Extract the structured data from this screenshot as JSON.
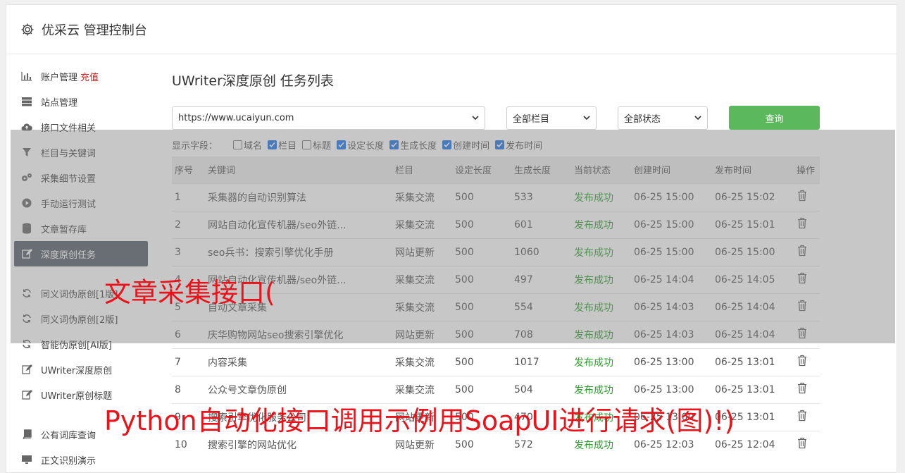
{
  "header": {
    "title": "优采云 管理控制台"
  },
  "sidebar": {
    "items": [
      {
        "label": "账户管理",
        "badge": "充值",
        "icon": "bar-chart-icon"
      },
      {
        "label": "站点管理",
        "icon": "server-icon"
      },
      {
        "label": "接口文件相关",
        "icon": "cloud-upload-icon"
      },
      {
        "label": "栏目与关键词",
        "icon": "filter-icon"
      },
      {
        "label": "采集细节设置",
        "icon": "gears-icon"
      },
      {
        "label": "手动运行测试",
        "icon": "play-icon"
      },
      {
        "label": "文章暂存库",
        "icon": "database-icon"
      },
      {
        "label": "深度原创任务",
        "icon": "edit-icon"
      },
      {
        "label": "同义词伪原创[1版]",
        "icon": "refresh-icon"
      },
      {
        "label": "同义词伪原创[2版]",
        "icon": "refresh-icon"
      },
      {
        "label": "智能伪原创[AI版]",
        "icon": "refresh-icon"
      },
      {
        "label": "UWriter深度原创",
        "icon": "edit-icon"
      },
      {
        "label": "UWriter原创标题",
        "icon": "edit-icon"
      },
      {
        "label": "公有词库查询",
        "icon": "book-icon"
      },
      {
        "label": "正文识别演示",
        "icon": "monitor-icon"
      }
    ]
  },
  "main": {
    "title": "UWriter深度原创 任务列表",
    "site_select": "https://www.ucaiyun.com",
    "column_select": "全部栏目",
    "status_select": "全部状态",
    "query_label": "查询",
    "fields_label": "显示字段：",
    "fields": [
      {
        "label": "域名",
        "checked": false
      },
      {
        "label": "栏目",
        "checked": true
      },
      {
        "label": "标题",
        "checked": false
      },
      {
        "label": "设定长度",
        "checked": true
      },
      {
        "label": "生成长度",
        "checked": true
      },
      {
        "label": "创建时间",
        "checked": true
      },
      {
        "label": "发布时间",
        "checked": true
      }
    ],
    "columns": [
      "序号",
      "关键词",
      "栏目",
      "设定长度",
      "生成长度",
      "当前状态",
      "创建时间",
      "发布时间",
      "操作"
    ],
    "rows": [
      [
        "1",
        "采集器的自动识别算法",
        "采集交流",
        "500",
        "533",
        "发布成功",
        "06-25 15:00",
        "06-25 15:02"
      ],
      [
        "2",
        "网站自动化宣传机器/seo外链...",
        "采集交流",
        "500",
        "601",
        "发布成功",
        "06-25 15:00",
        "06-25 15:01"
      ],
      [
        "3",
        "seo兵书：搜索引擎优化手册",
        "网站更新",
        "500",
        "1060",
        "发布成功",
        "06-25 15:00",
        "06-25 15:00"
      ],
      [
        "4",
        "网站自动化宣传机器/seo外链...",
        "采集交流",
        "500",
        "497",
        "发布成功",
        "06-25 14:04",
        "06-25 14:05"
      ],
      [
        "5",
        "自动文章采集",
        "采集交流",
        "500",
        "554",
        "发布成功",
        "06-25 14:03",
        "06-25 14:04"
      ],
      [
        "6",
        "庆华购物网站seo搜索引擎优化",
        "网站更新",
        "500",
        "708",
        "发布成功",
        "06-25 14:03",
        "06-25 14:04"
      ],
      [
        "7",
        "内容采集",
        "采集交流",
        "500",
        "1017",
        "发布成功",
        "06-25 13:00",
        "06-25 13:01"
      ],
      [
        "8",
        "公众号文章伪原创",
        "采集交流",
        "500",
        "504",
        "发布成功",
        "06-25 13:00",
        "06-25 13:01"
      ],
      [
        "9",
        "搜索引擎优化服务公司",
        "网站更新",
        "500",
        "470",
        "发布成功",
        "06-25 13:00",
        "06-25 13:01"
      ],
      [
        "10",
        "搜索引擎的网站优化",
        "网站更新",
        "500",
        "572",
        "发布成功",
        "06-25 12:03",
        "06-25 12:04"
      ]
    ]
  },
  "watermark": {
    "line1": "文章采集接口(",
    "line2": "Python自动化接口调用示例用SoapUI进行请求(图)!)"
  },
  "colors": {
    "active_nav": "#555e68",
    "query_button": "#5cb85c",
    "status_success": "#2e9e2e",
    "watermark": "#e8141c"
  }
}
